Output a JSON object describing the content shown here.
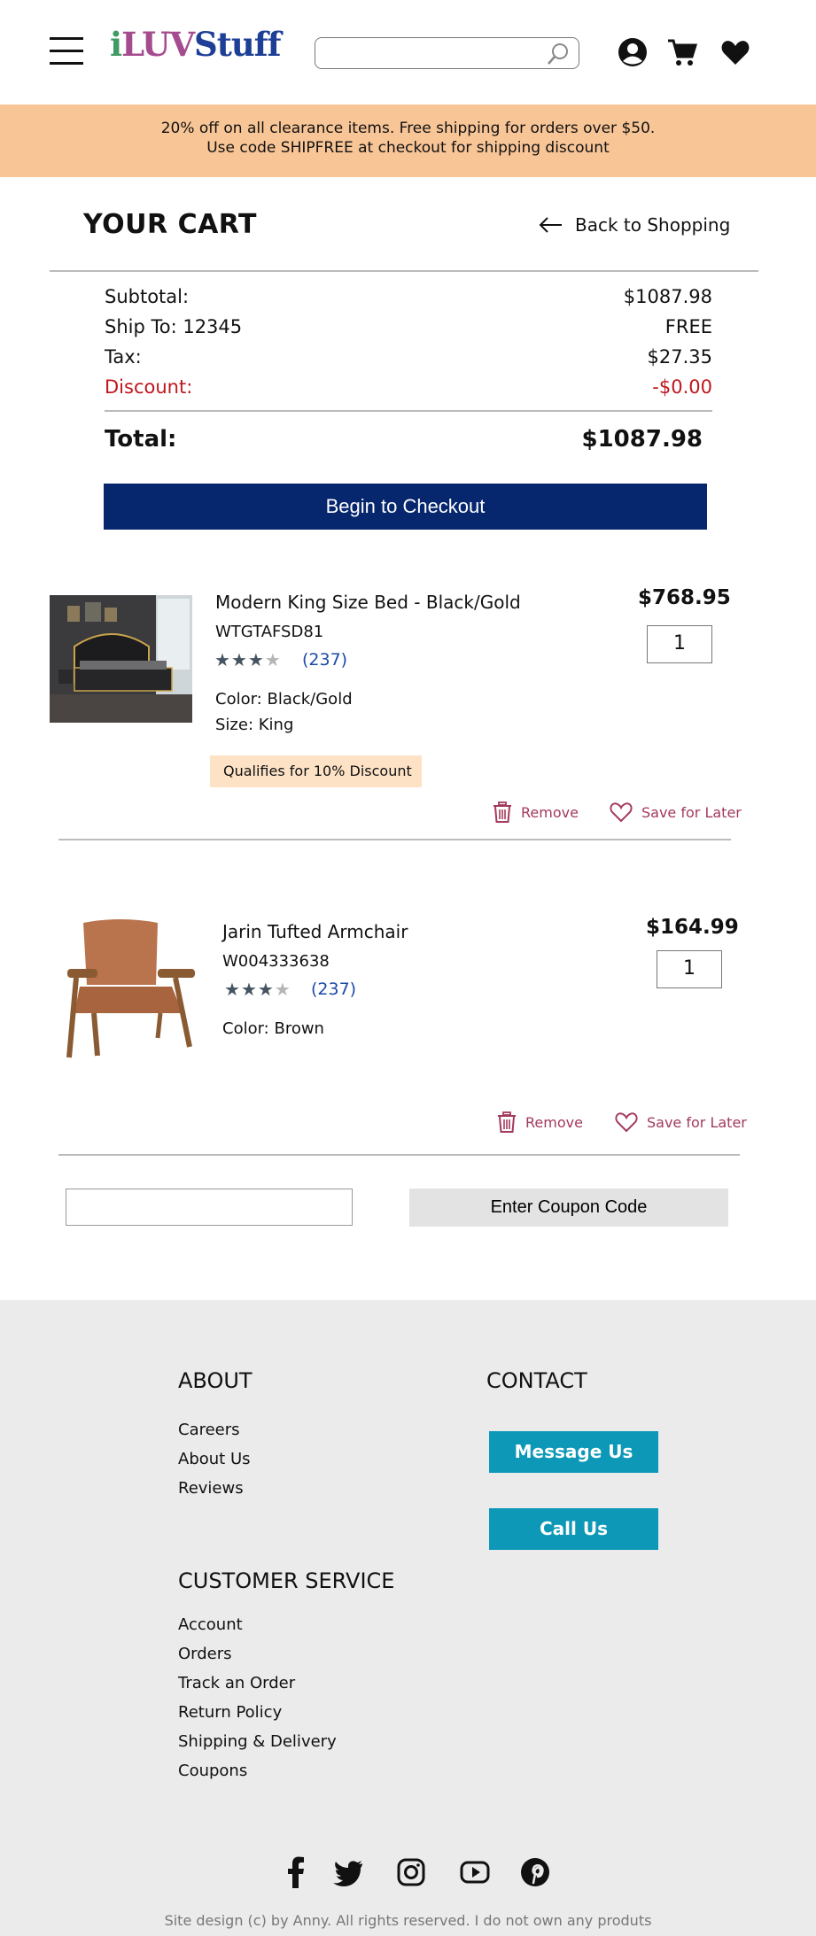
{
  "header": {
    "logo": {
      "part1": "i",
      "part2": "LUV",
      "part3": "Stuff"
    },
    "search": {
      "placeholder": "",
      "value": ""
    },
    "icons": [
      "menu-icon",
      "search-icon",
      "user-icon",
      "cart-icon",
      "heart-icon"
    ]
  },
  "promo": {
    "line1": "20% off on all clearance items. Free shipping for orders over $50.",
    "line2": "Use code SHIPFREE at checkout for shipping discount"
  },
  "cart": {
    "title": "YOUR CART",
    "back_label": "Back to Shopping"
  },
  "summary": {
    "subtotal_label": "Subtotal:",
    "subtotal_value": "$1087.98",
    "ship_label": "Ship To: 12345",
    "ship_value": "FREE",
    "tax_label": "Tax:",
    "tax_value": "$27.35",
    "discount_label": "Discount:",
    "discount_value": "-$0.00",
    "total_label": "Total:",
    "total_value": "$1087.98",
    "checkout_label": "Begin to Checkout"
  },
  "items": [
    {
      "name": "Modern King Size Bed - Black/Gold",
      "sku": "WTGTAFSD81",
      "rating": 3.5,
      "reviews": "(237)",
      "color": "Color: Black/Gold",
      "size": "Size: King",
      "price": "$768.95",
      "qty": "1",
      "badge": "Qualifies for 10% Discount",
      "remove_label": "Remove",
      "save_label": "Save for Later"
    },
    {
      "name": "Jarin Tufted Armchair",
      "sku": "W004333638",
      "rating": 3.5,
      "reviews": "(237)",
      "color": "Color: Brown",
      "price": "$164.99",
      "qty": "1",
      "remove_label": "Remove",
      "save_label": "Save for Later"
    }
  ],
  "coupon": {
    "input_value": "",
    "button_label": "Enter Coupon Code"
  },
  "footer": {
    "about": {
      "heading": "ABOUT",
      "links": [
        "Careers",
        "About Us",
        "Reviews"
      ]
    },
    "contact": {
      "heading": "CONTACT",
      "message_label": "Message Us",
      "call_label": "Call Us"
    },
    "customer_service": {
      "heading": "CUSTOMER SERVICE",
      "links": [
        "Account",
        "Orders",
        "Track an Order",
        "Return Policy",
        "Shipping & Delivery",
        "Coupons"
      ]
    },
    "social": [
      "facebook-icon",
      "twitter-icon",
      "instagram-icon",
      "youtube-icon",
      "pinterest-icon"
    ],
    "copyright": "Site design (c) by Anny. All rights reserved. I do not own any produts"
  },
  "colors": {
    "promo_bg": "#f8c597",
    "checkout_bg": "#06266d",
    "discount_red": "#c0161c",
    "action_color": "#a33a5c",
    "footer_btn": "#0d98b7",
    "footer_bg": "#ebebeb"
  }
}
